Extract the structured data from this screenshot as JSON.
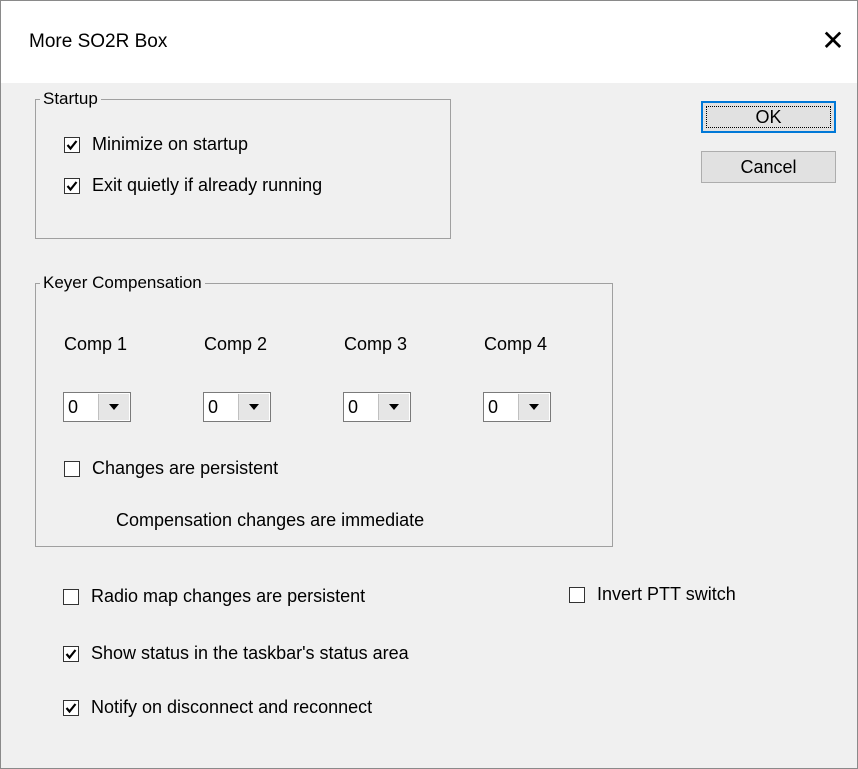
{
  "window": {
    "title": "More SO2R Box",
    "close_icon": "close-icon"
  },
  "startup": {
    "legend": "Startup",
    "minimize_label": "Minimize on startup",
    "minimize_checked": true,
    "exit_quietly_label": "Exit quietly if already running",
    "exit_quietly_checked": true
  },
  "keyer": {
    "legend": "Keyer Compensation",
    "comps": [
      {
        "label": "Comp 1",
        "value": "0"
      },
      {
        "label": "Comp 2",
        "value": "0"
      },
      {
        "label": "Comp 3",
        "value": "0"
      },
      {
        "label": "Comp 4",
        "value": "0"
      }
    ],
    "persistent_label": "Changes are persistent",
    "persistent_checked": false,
    "note": "Compensation changes are immediate"
  },
  "options": {
    "radio_map_label": "Radio map changes are persistent",
    "radio_map_checked": false,
    "invert_ptt_label": "Invert PTT switch",
    "invert_ptt_checked": false,
    "show_status_label": "Show status in the taskbar's status area",
    "show_status_checked": true,
    "notify_label": "Notify on disconnect and reconnect",
    "notify_checked": true
  },
  "buttons": {
    "ok": "OK",
    "cancel": "Cancel"
  }
}
